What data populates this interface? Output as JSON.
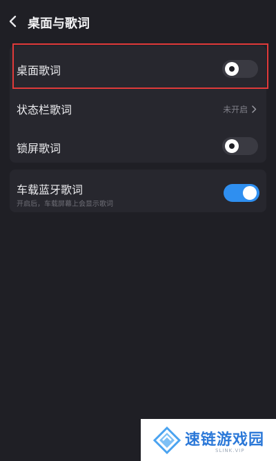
{
  "header": {
    "back_icon": "chevron-left-icon",
    "title": "桌面与歌词"
  },
  "settings": {
    "items": [
      {
        "label": "桌面歌词",
        "toggle": "off"
      },
      {
        "label": "状态栏歌词",
        "status": "未开启"
      },
      {
        "label": "锁屏歌词",
        "toggle": "off"
      }
    ]
  },
  "bluetooth": {
    "label": "车载蓝牙歌词",
    "sublabel": "开启后，车载屏幕上会显示歌词",
    "toggle": "on"
  },
  "colors": {
    "background": "#1f1f25",
    "card": "#27272e",
    "accent": "#2f8ff0",
    "highlight": "#e23a3a"
  },
  "watermark": {
    "text": "速链游戏园",
    "sub": "SLINK.VIP",
    "logo_icon": "diamond-logo-icon"
  }
}
